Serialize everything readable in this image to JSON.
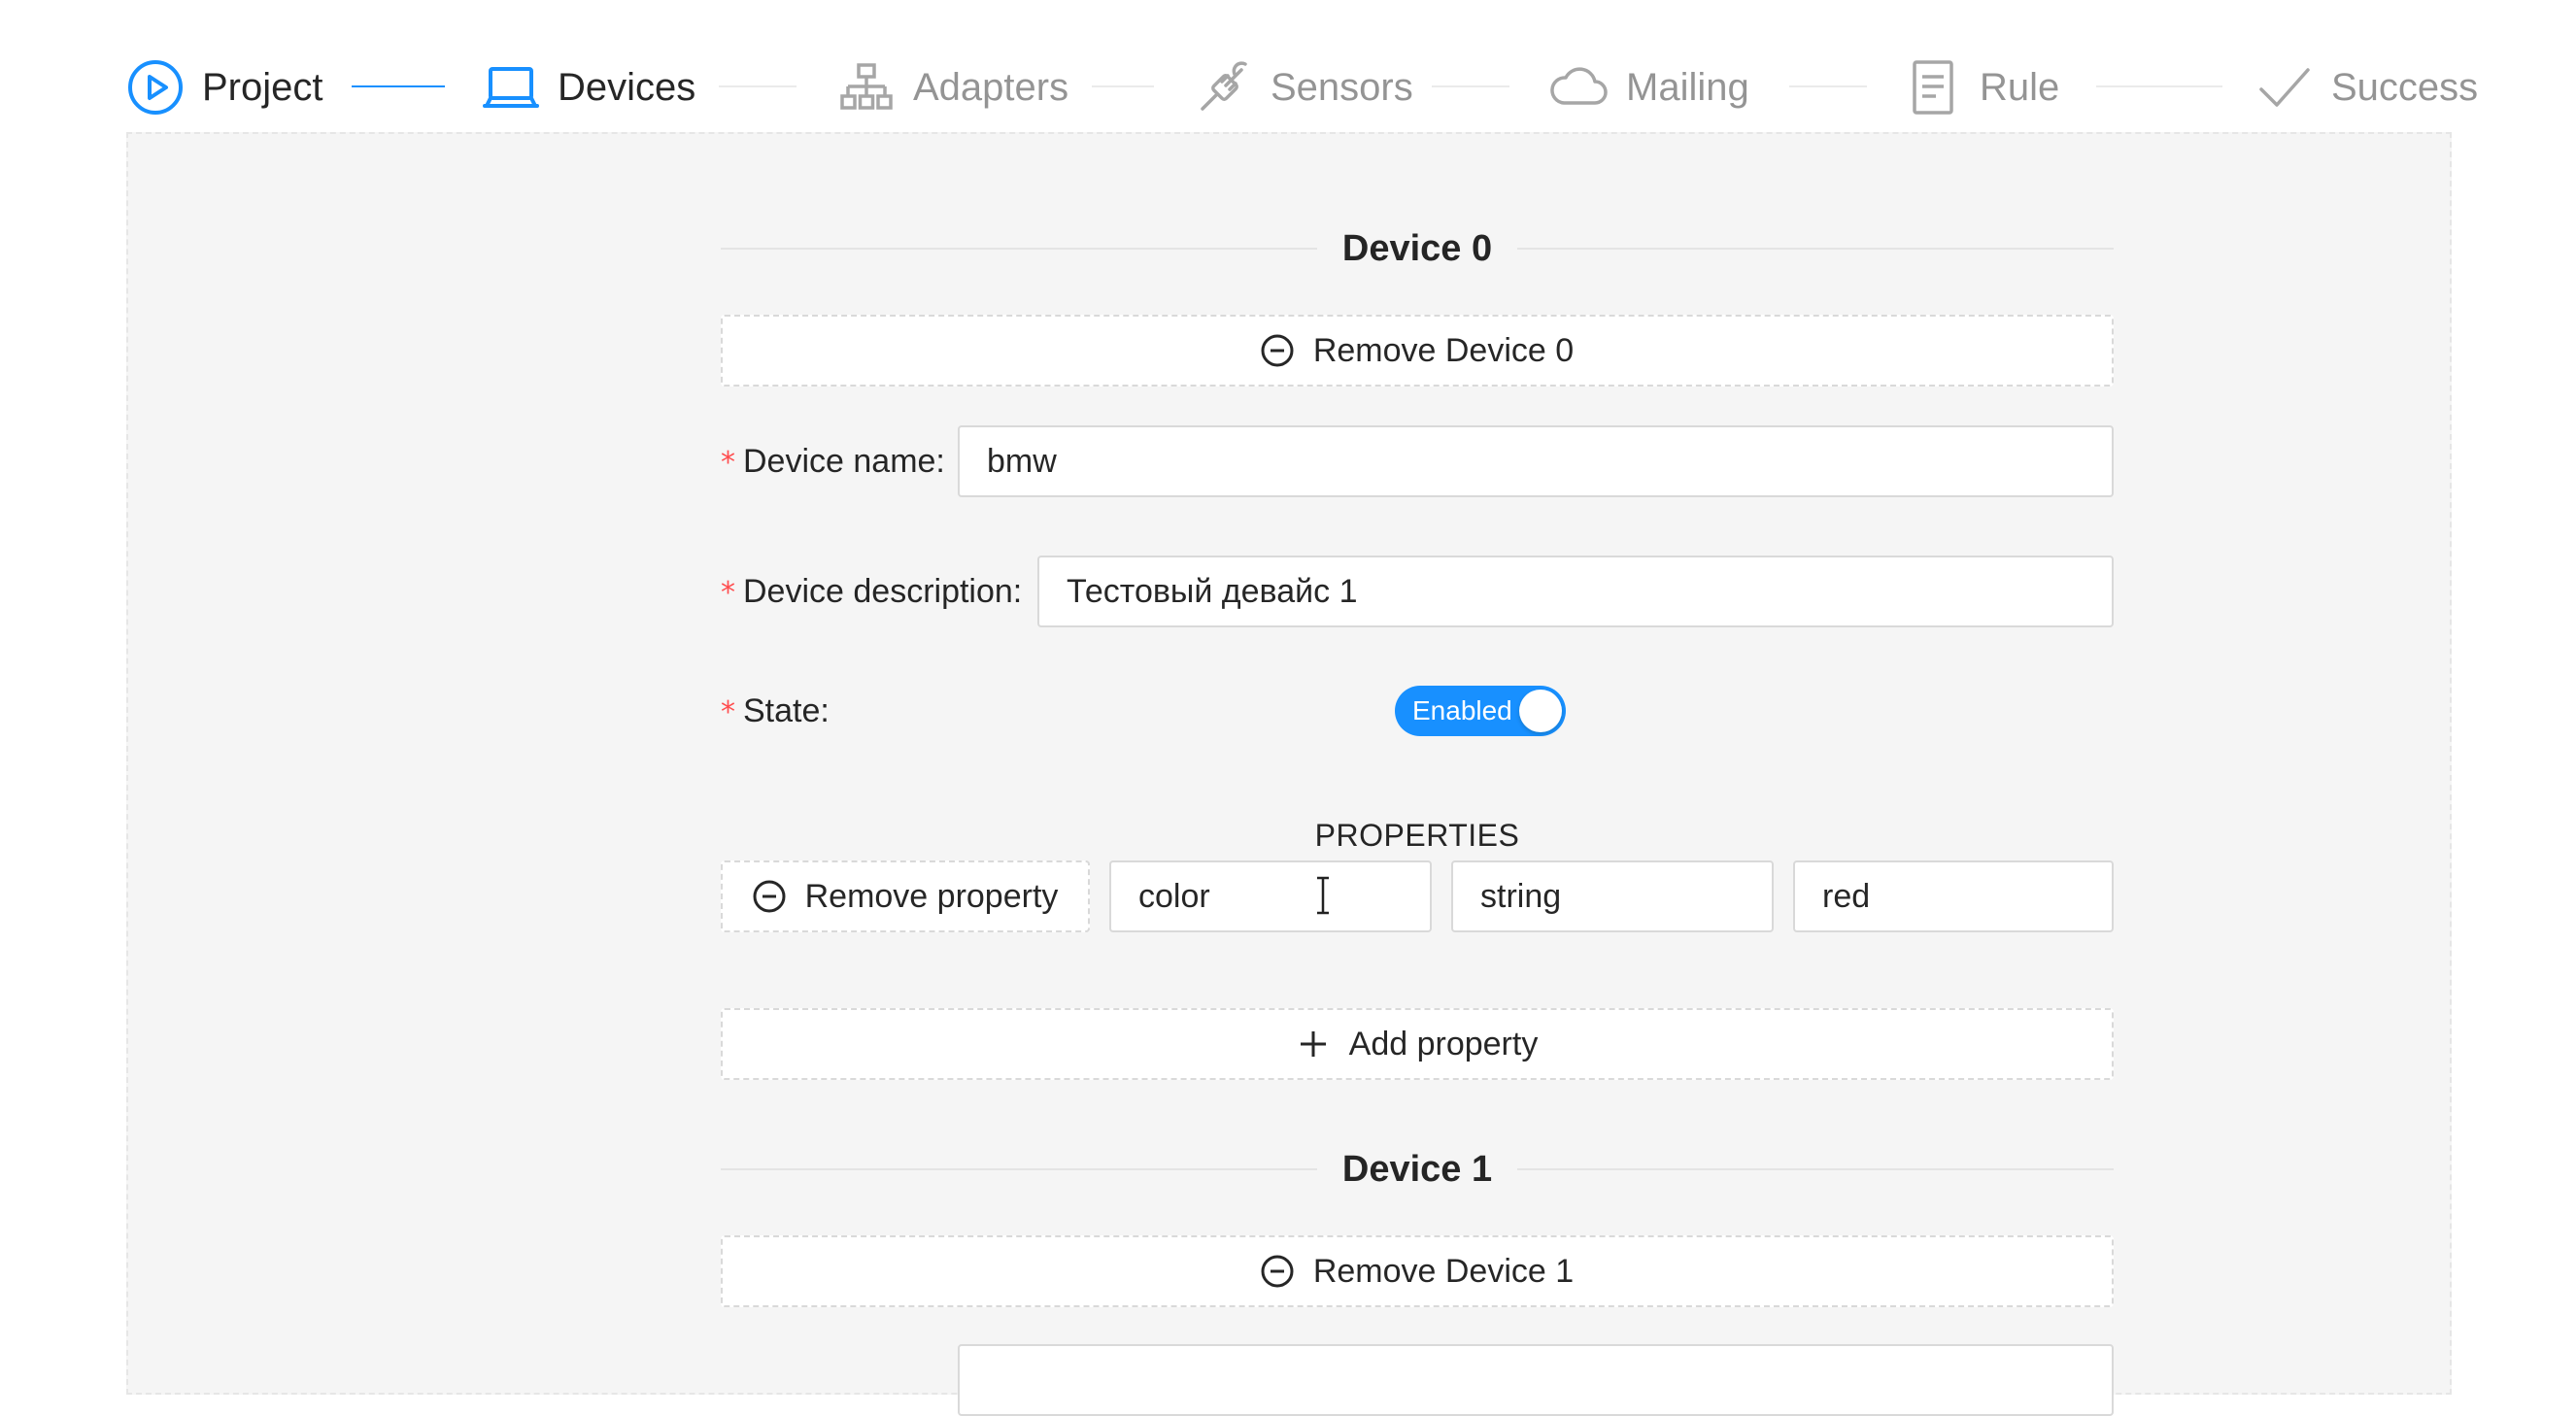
{
  "steps": [
    {
      "label": "Project",
      "status": "done",
      "icon": "play-circle-icon"
    },
    {
      "label": "Devices",
      "status": "active",
      "icon": "laptop-icon"
    },
    {
      "label": "Adapters",
      "status": "wait",
      "icon": "network-icon"
    },
    {
      "label": "Sensors",
      "status": "wait",
      "icon": "plug-icon"
    },
    {
      "label": "Mailing",
      "status": "wait",
      "icon": "cloud-icon"
    },
    {
      "label": "Rule",
      "status": "wait",
      "icon": "document-icon"
    },
    {
      "label": "Success",
      "status": "wait",
      "icon": "check-icon"
    }
  ],
  "colors": {
    "primary": "#1890ff",
    "required": "#ff4d4f",
    "panel_bg": "#f5f5f5",
    "inactive_text": "#a6a6a6"
  },
  "devices": [
    {
      "title": "Device 0",
      "remove_label": "Remove Device 0",
      "name_label": "Device name",
      "name_value": "bmw",
      "description_label": "Device description",
      "description_value": "Тестовый девайс 1",
      "state_label": "State",
      "state_switch_text": "Enabled",
      "state_enabled": true,
      "properties_title": "PROPERTIES",
      "properties": [
        {
          "remove_label": "Remove property",
          "name": "color",
          "type": "string",
          "value": "red"
        }
      ],
      "add_property_label": "Add property"
    },
    {
      "title": "Device 1",
      "remove_label": "Remove Device 1"
    }
  ]
}
